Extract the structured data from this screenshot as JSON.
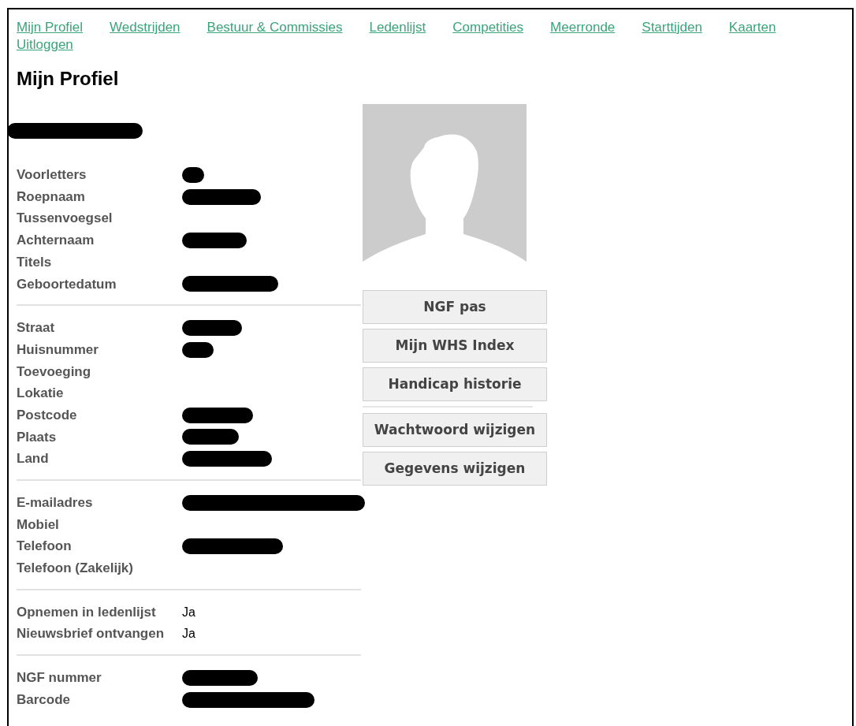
{
  "nav": [
    {
      "label": "Mijn Profiel"
    },
    {
      "label": "Wedstrijden"
    },
    {
      "label": "Bestuur & Commissies"
    },
    {
      "label": "Ledenlijst"
    },
    {
      "label": "Competities"
    },
    {
      "label": "Meerronde"
    },
    {
      "label": "Starttijden"
    },
    {
      "label": "Kaarten"
    },
    {
      "label": "Uitloggen"
    }
  ],
  "page_title": "Mijn Profiel",
  "name_redacted": true,
  "sections": [
    {
      "fields": [
        {
          "label": "Voorletters",
          "redacted": true
        },
        {
          "label": "Roepnaam",
          "redacted": true
        },
        {
          "label": "Tussenvoegsel",
          "redacted": false
        },
        {
          "label": "Achternaam",
          "redacted": true
        },
        {
          "label": "Titels",
          "redacted": false
        },
        {
          "label": "Geboortedatum",
          "redacted": true
        }
      ]
    },
    {
      "fields": [
        {
          "label": "Straat",
          "redacted": true
        },
        {
          "label": "Huisnummer",
          "redacted": true
        },
        {
          "label": "Toevoeging",
          "redacted": false
        },
        {
          "label": "Lokatie",
          "redacted": false
        },
        {
          "label": "Postcode",
          "redacted": true
        },
        {
          "label": "Plaats",
          "redacted": true
        },
        {
          "label": "Land",
          "redacted": true
        }
      ]
    },
    {
      "fields": [
        {
          "label": "E-mailadres",
          "redacted": true
        },
        {
          "label": "Mobiel",
          "redacted": false
        },
        {
          "label": "Telefoon",
          "redacted": true
        },
        {
          "label": "Telefoon (Zakelijk)",
          "redacted": false
        }
      ]
    },
    {
      "fields": [
        {
          "label": "Opnemen in ledenlijst",
          "value": "Ja",
          "redacted": false
        },
        {
          "label": "Nieuwsbrief ontvangen",
          "value": "Ja",
          "redacted": false
        }
      ]
    },
    {
      "fields": [
        {
          "label": "NGF nummer",
          "redacted": true
        },
        {
          "label": "Barcode",
          "redacted": true
        }
      ]
    }
  ],
  "button_groups": [
    [
      "NGF pas",
      "Mijn WHS Index",
      "Handicap historie"
    ],
    [
      "Wachtwoord wijzigen",
      "Gegevens wijzigen"
    ]
  ]
}
